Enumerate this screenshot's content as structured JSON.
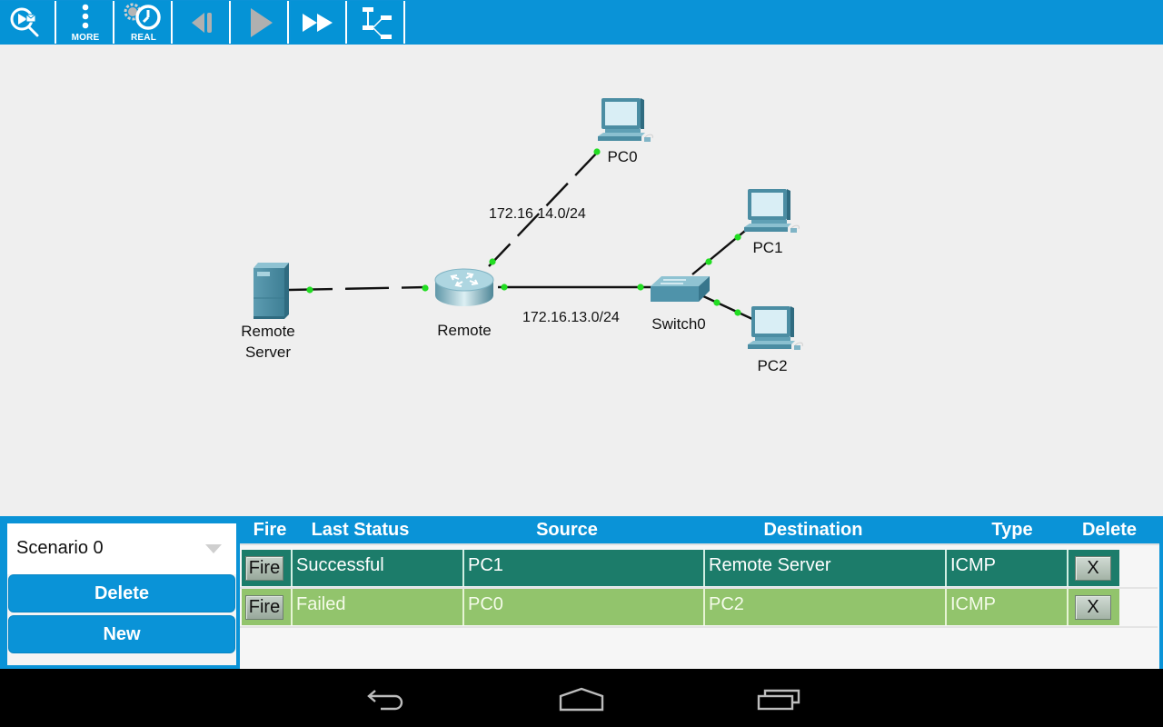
{
  "toolbar": {
    "buttons": [
      {
        "name": "inspect",
        "icon": "magnifier-envelope-icon",
        "label": ""
      },
      {
        "name": "more",
        "icon": "vertical-dots-icon",
        "label": "MORE"
      },
      {
        "name": "realtime",
        "icon": "clock-icon",
        "label": "REAL"
      },
      {
        "name": "step-back",
        "icon": "step-back-icon",
        "label": ""
      },
      {
        "name": "play",
        "icon": "play-icon",
        "label": ""
      },
      {
        "name": "fast-forward",
        "icon": "fast-forward-icon",
        "label": ""
      },
      {
        "name": "topology",
        "icon": "topology-icon",
        "label": ""
      }
    ]
  },
  "topology": {
    "devices": [
      {
        "id": "remote-server",
        "type": "server",
        "label_line1": "Remote",
        "label_line2": "Server"
      },
      {
        "id": "remote-router",
        "type": "router",
        "label": "Remote"
      },
      {
        "id": "pc0",
        "type": "pc",
        "label": "PC0"
      },
      {
        "id": "pc1",
        "type": "pc",
        "label": "PC1"
      },
      {
        "id": "pc2",
        "type": "pc",
        "label": "PC2"
      },
      {
        "id": "switch0",
        "type": "switch",
        "label": "Switch0"
      }
    ],
    "networks": [
      {
        "label": "172.16.14.0/24"
      },
      {
        "label": "172.16.13.0/24"
      }
    ],
    "link_status_color": "#22dd22"
  },
  "scenario": {
    "selected": "Scenario 0",
    "delete_label": "Delete",
    "new_label": "New"
  },
  "pdu_table": {
    "headers": {
      "fire": "Fire",
      "last_status": "Last Status",
      "source": "Source",
      "destination": "Destination",
      "type": "Type",
      "delete": "Delete"
    },
    "rows": [
      {
        "fire": "Fire",
        "last_status": "Successful",
        "source": "PC1",
        "destination": "Remote Server",
        "type": "ICMP",
        "delete": "X",
        "color": "#1c7c6a"
      },
      {
        "fire": "Fire",
        "last_status": "Failed",
        "source": "PC0",
        "destination": "PC2",
        "type": "ICMP",
        "delete": "X",
        "color": "#92c46c"
      }
    ]
  },
  "navbar": {
    "buttons": [
      {
        "name": "back",
        "icon": "back-arrow-icon"
      },
      {
        "name": "home",
        "icon": "home-icon"
      },
      {
        "name": "recents",
        "icon": "recent-apps-icon"
      }
    ]
  },
  "colors": {
    "accent": "#0a93d7",
    "canvas_bg": "#efefef",
    "success_row": "#1c7c6a",
    "failed_row": "#92c46c"
  }
}
